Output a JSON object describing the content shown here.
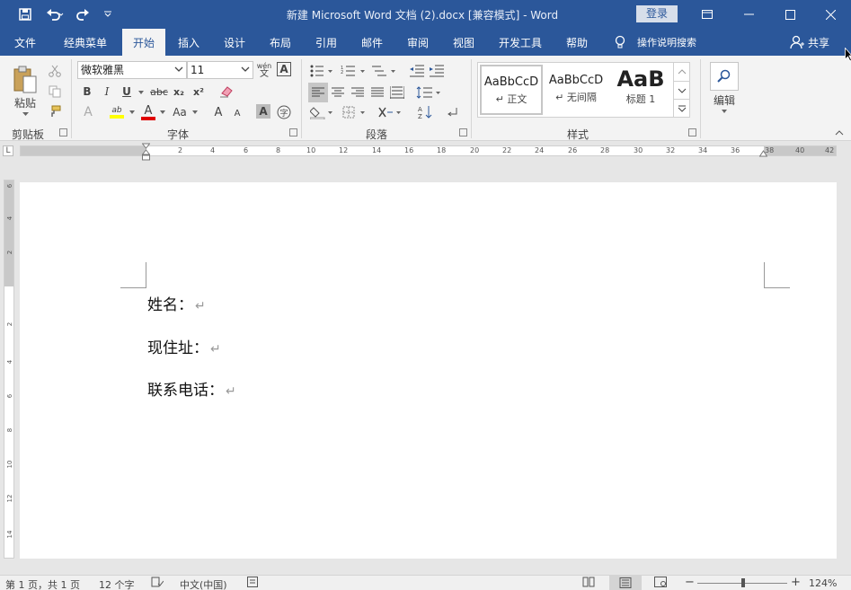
{
  "app": {
    "title": "新建 Microsoft Word 文档 (2).docx [兼容模式]  -  Word",
    "login_label": "登录"
  },
  "tabs": [
    {
      "label": "文件"
    },
    {
      "label": "经典菜单"
    },
    {
      "label": "开始",
      "active": true
    },
    {
      "label": "插入"
    },
    {
      "label": "设计"
    },
    {
      "label": "布局"
    },
    {
      "label": "引用"
    },
    {
      "label": "邮件"
    },
    {
      "label": "审阅"
    },
    {
      "label": "视图"
    },
    {
      "label": "开发工具"
    },
    {
      "label": "帮助"
    }
  ],
  "tell_me": "操作说明搜索",
  "share": "共享",
  "ribbon": {
    "clipboard": {
      "paste_label": "粘贴",
      "group_label": "剪贴板"
    },
    "font": {
      "font_name": "微软雅黑",
      "font_size": "11",
      "group_label": "字体",
      "phonetic_top": "wén",
      "phonetic_bottom": "文",
      "bold": "B",
      "italic": "I",
      "underline": "U",
      "strike": "abc",
      "subscript": "x₂",
      "superscript": "x²",
      "case": "Aa",
      "grow": "A",
      "shrink": "A"
    },
    "paragraph": {
      "group_label": "段落"
    },
    "styles": {
      "group_label": "样式",
      "items": [
        {
          "sample": "AaBbCcD",
          "name": "↵ 正文"
        },
        {
          "sample": "AaBbCcD",
          "name": "↵ 无间隔"
        },
        {
          "sample": "AaB",
          "name": "标题 1"
        }
      ]
    },
    "editing": {
      "label": "编辑"
    }
  },
  "ruler": {
    "h_labels": [
      "L",
      "2",
      "4",
      "6",
      "8",
      "10",
      "12",
      "14",
      "16",
      "18",
      "20",
      "22",
      "24",
      "26",
      "28",
      "30",
      "32",
      "34",
      "36",
      "38",
      "40",
      "42"
    ],
    "v_labels": [
      "6",
      "4",
      "2",
      "2",
      "4",
      "6",
      "8",
      "10",
      "12",
      "14"
    ]
  },
  "document": {
    "lines": [
      {
        "text": "姓名：",
        "mark": "↵"
      },
      {
        "text": "现住址：",
        "mark": "↵"
      },
      {
        "text": "联系电话：",
        "mark": "↵"
      }
    ]
  },
  "status": {
    "page": "第 1 页，共 1 页",
    "words": "12 个字",
    "language": "中文(中国)",
    "zoom": "124%"
  },
  "colors": {
    "brand": "#2b579a",
    "highlight": "#ffff00",
    "font_color": "#e00000"
  }
}
